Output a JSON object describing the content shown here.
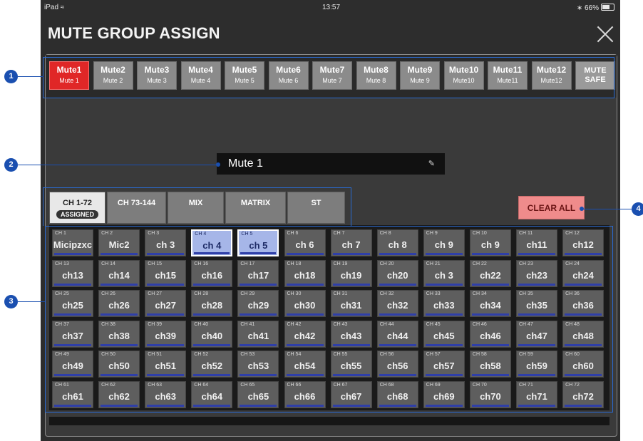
{
  "status": {
    "device": "iPad",
    "time": "13:57",
    "battery": "66%"
  },
  "title": "MUTE GROUP ASSIGN",
  "mute_groups": [
    {
      "l1": "Mute1",
      "l2": "Mute 1",
      "active": true
    },
    {
      "l1": "Mute2",
      "l2": "Mute 2"
    },
    {
      "l1": "Mute3",
      "l2": "Mute 3"
    },
    {
      "l1": "Mute4",
      "l2": "Mute 4"
    },
    {
      "l1": "Mute5",
      "l2": "Mute 5"
    },
    {
      "l1": "Mute6",
      "l2": "Mute 6"
    },
    {
      "l1": "Mute7",
      "l2": "Mute 7"
    },
    {
      "l1": "Mute8",
      "l2": "Mute 8"
    },
    {
      "l1": "Mute9",
      "l2": "Mute 9"
    },
    {
      "l1": "Mute10",
      "l2": "Mute10"
    },
    {
      "l1": "Mute11",
      "l2": "Mute11"
    },
    {
      "l1": "Mute12",
      "l2": "Mute12"
    },
    {
      "l1": "MUTE",
      "l2": "SAFE",
      "safe": true
    }
  ],
  "selected_group_name": "Mute 1",
  "tabs": [
    {
      "label": "CH 1-72",
      "badge": "ASSIGNED",
      "active": true
    },
    {
      "label": "CH 73-144"
    },
    {
      "label": "MIX"
    },
    {
      "label": "MATRIX"
    },
    {
      "label": "ST"
    }
  ],
  "clear_all": "CLEAR ALL",
  "channels": [
    {
      "num": "CH 1",
      "name": "Micipzxc"
    },
    {
      "num": "CH 2",
      "name": "Mic2"
    },
    {
      "num": "CH 3",
      "name": "ch 3"
    },
    {
      "num": "CH 4",
      "name": "ch 4",
      "selected": true
    },
    {
      "num": "CH 5",
      "name": "ch 5",
      "selected": true
    },
    {
      "num": "CH 6",
      "name": "ch 6"
    },
    {
      "num": "CH 7",
      "name": "ch 7"
    },
    {
      "num": "CH 8",
      "name": "ch 8"
    },
    {
      "num": "CH 9",
      "name": "ch 9"
    },
    {
      "num": "CH 10",
      "name": "ch 9"
    },
    {
      "num": "CH 11",
      "name": "ch11"
    },
    {
      "num": "CH 12",
      "name": "ch12"
    },
    {
      "num": "CH 13",
      "name": "ch13"
    },
    {
      "num": "CH 14",
      "name": "ch14"
    },
    {
      "num": "CH 15",
      "name": "ch15"
    },
    {
      "num": "CH 16",
      "name": "ch16"
    },
    {
      "num": "CH 17",
      "name": "ch17"
    },
    {
      "num": "CH 18",
      "name": "ch18"
    },
    {
      "num": "CH 19",
      "name": "ch19"
    },
    {
      "num": "CH 20",
      "name": "ch20"
    },
    {
      "num": "CH 21",
      "name": "ch 3"
    },
    {
      "num": "CH 22",
      "name": "ch22"
    },
    {
      "num": "CH 23",
      "name": "ch23"
    },
    {
      "num": "CH 24",
      "name": "ch24"
    },
    {
      "num": "CH 25",
      "name": "ch25"
    },
    {
      "num": "CH 26",
      "name": "ch26"
    },
    {
      "num": "CH 27",
      "name": "ch27"
    },
    {
      "num": "CH 28",
      "name": "ch28"
    },
    {
      "num": "CH 29",
      "name": "ch29"
    },
    {
      "num": "CH 30",
      "name": "ch30"
    },
    {
      "num": "CH 31",
      "name": "ch31"
    },
    {
      "num": "CH 32",
      "name": "ch32"
    },
    {
      "num": "CH 33",
      "name": "ch33"
    },
    {
      "num": "CH 34",
      "name": "ch34"
    },
    {
      "num": "CH 35",
      "name": "ch35"
    },
    {
      "num": "CH 36",
      "name": "ch36"
    },
    {
      "num": "CH 37",
      "name": "ch37"
    },
    {
      "num": "CH 38",
      "name": "ch38"
    },
    {
      "num": "CH 39",
      "name": "ch39"
    },
    {
      "num": "CH 40",
      "name": "ch40"
    },
    {
      "num": "CH 41",
      "name": "ch41"
    },
    {
      "num": "CH 42",
      "name": "ch42"
    },
    {
      "num": "CH 43",
      "name": "ch43"
    },
    {
      "num": "CH 44",
      "name": "ch44"
    },
    {
      "num": "CH 45",
      "name": "ch45"
    },
    {
      "num": "CH 46",
      "name": "ch46"
    },
    {
      "num": "CH 47",
      "name": "ch47"
    },
    {
      "num": "CH 48",
      "name": "ch48"
    },
    {
      "num": "CH 49",
      "name": "ch49"
    },
    {
      "num": "CH 50",
      "name": "ch50"
    },
    {
      "num": "CH 51",
      "name": "ch51"
    },
    {
      "num": "CH 52",
      "name": "ch52"
    },
    {
      "num": "CH 53",
      "name": "ch53"
    },
    {
      "num": "CH 54",
      "name": "ch54"
    },
    {
      "num": "CH 55",
      "name": "ch55"
    },
    {
      "num": "CH 56",
      "name": "ch56"
    },
    {
      "num": "CH 57",
      "name": "ch57"
    },
    {
      "num": "CH 58",
      "name": "ch58"
    },
    {
      "num": "CH 59",
      "name": "ch59"
    },
    {
      "num": "CH 60",
      "name": "ch60"
    },
    {
      "num": "CH 61",
      "name": "ch61"
    },
    {
      "num": "CH 62",
      "name": "ch62"
    },
    {
      "num": "CH 63",
      "name": "ch63"
    },
    {
      "num": "CH 64",
      "name": "ch64"
    },
    {
      "num": "CH 65",
      "name": "ch65"
    },
    {
      "num": "CH 66",
      "name": "ch66"
    },
    {
      "num": "CH 67",
      "name": "ch67"
    },
    {
      "num": "CH 68",
      "name": "ch68"
    },
    {
      "num": "CH 69",
      "name": "ch69"
    },
    {
      "num": "CH 70",
      "name": "ch70"
    },
    {
      "num": "CH 71",
      "name": "ch71"
    },
    {
      "num": "CH 72",
      "name": "ch72"
    }
  ],
  "callouts": [
    "1",
    "2",
    "3",
    "4"
  ],
  "colors": {
    "active_mute": "#e02727",
    "selected_channel": "#a6b6e8",
    "clear_all": "#ef8b8b",
    "callout": "#1a4fb0"
  }
}
